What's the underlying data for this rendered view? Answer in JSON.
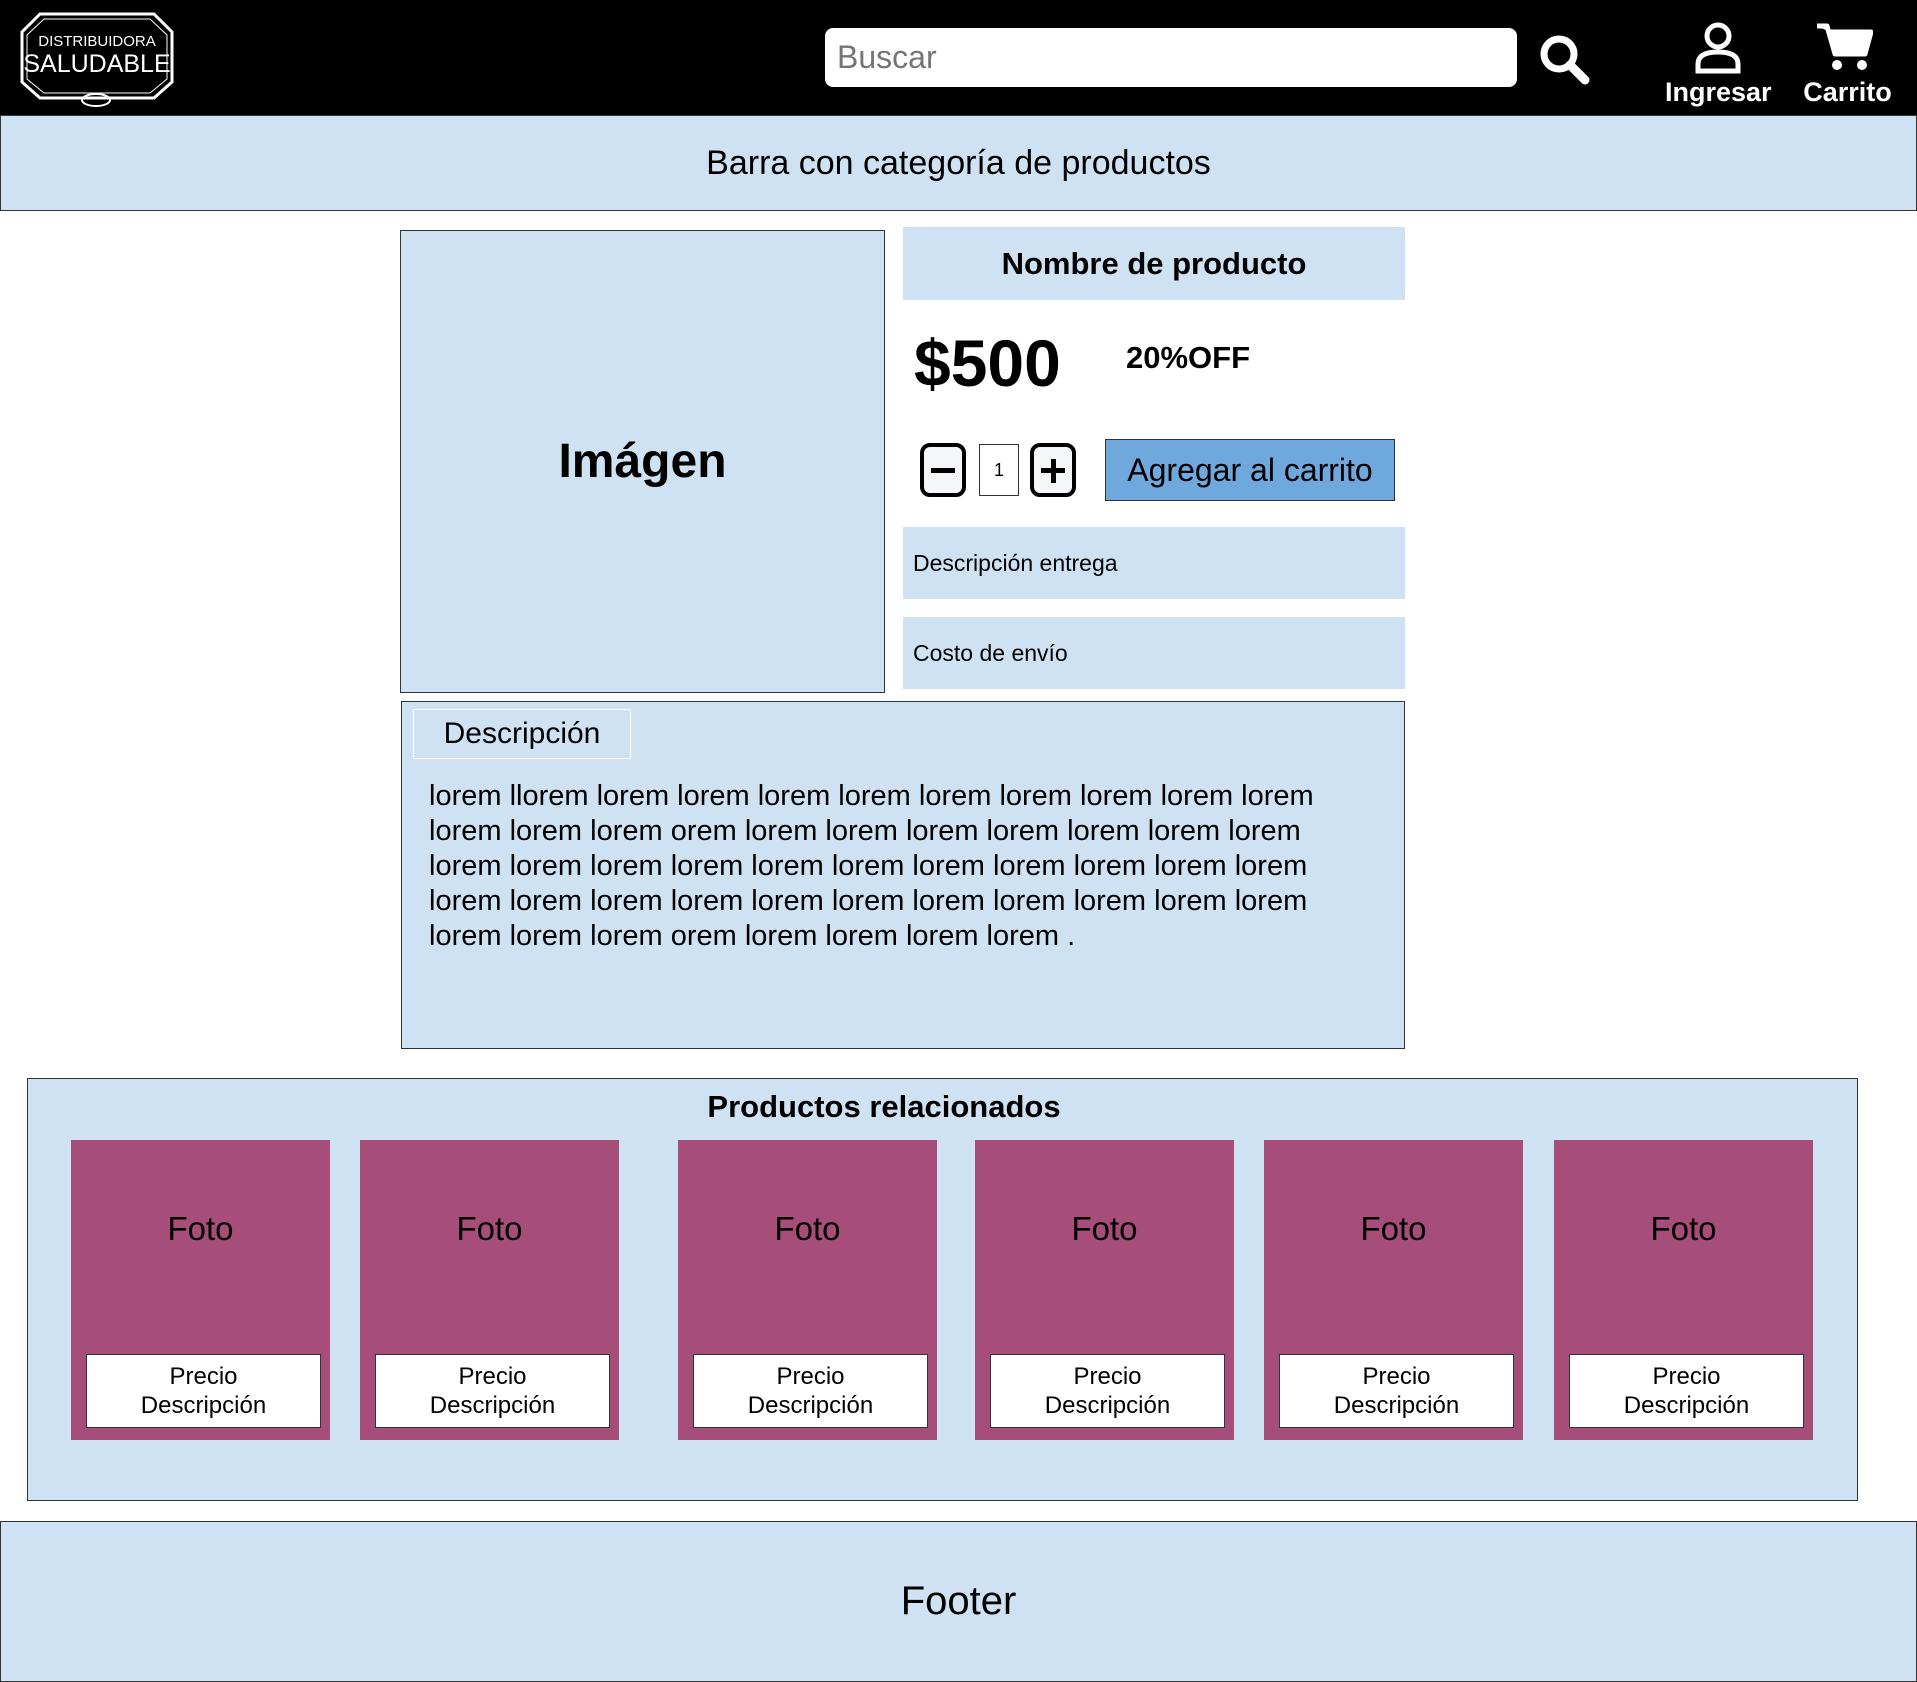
{
  "header": {
    "logo": {
      "line1": "DISTRIBUIDORA",
      "line2": "SALUDABLE"
    },
    "search_placeholder": "Buscar",
    "login_label": "Ingresar",
    "cart_label": "Carrito"
  },
  "category_bar": {
    "label": "Barra con categoría de productos"
  },
  "product": {
    "image_label": "Imágen",
    "name": "Nombre de producto",
    "price": "$500",
    "discount": "20%OFF",
    "quantity": "1",
    "add_to_cart_label": "Agregar al carrito",
    "delivery_label": "Descripción entrega",
    "shipping_label": "Costo de envío"
  },
  "description": {
    "tab_label": "Descripción",
    "text": "lorem llorem lorem lorem lorem lorem lorem lorem lorem lorem lorem\nlorem lorem lorem orem lorem lorem lorem lorem lorem lorem lorem\nlorem lorem lorem lorem lorem lorem lorem lorem lorem lorem lorem\nlorem lorem lorem lorem lorem lorem lorem lorem lorem lorem lorem\nlorem lorem lorem orem lorem lorem lorem lorem ."
  },
  "related": {
    "title": "Productos relacionados",
    "items": [
      {
        "photo": "Foto",
        "price": "Precio",
        "description": "Descripción"
      },
      {
        "photo": "Foto",
        "price": "Precio",
        "description": "Descripción"
      },
      {
        "photo": "Foto",
        "price": "Precio",
        "description": "Descripción"
      },
      {
        "photo": "Foto",
        "price": "Precio",
        "description": "Descripción"
      },
      {
        "photo": "Foto",
        "price": "Precio",
        "description": "Descripción"
      },
      {
        "photo": "Foto",
        "price": "Precio",
        "description": "Descripción"
      }
    ]
  },
  "footer": {
    "label": "Footer"
  },
  "colors": {
    "header_bg": "#000000",
    "panel_bg": "#cfe2f3",
    "button_bg": "#6fa8dc",
    "card_bg": "#a64d79"
  }
}
